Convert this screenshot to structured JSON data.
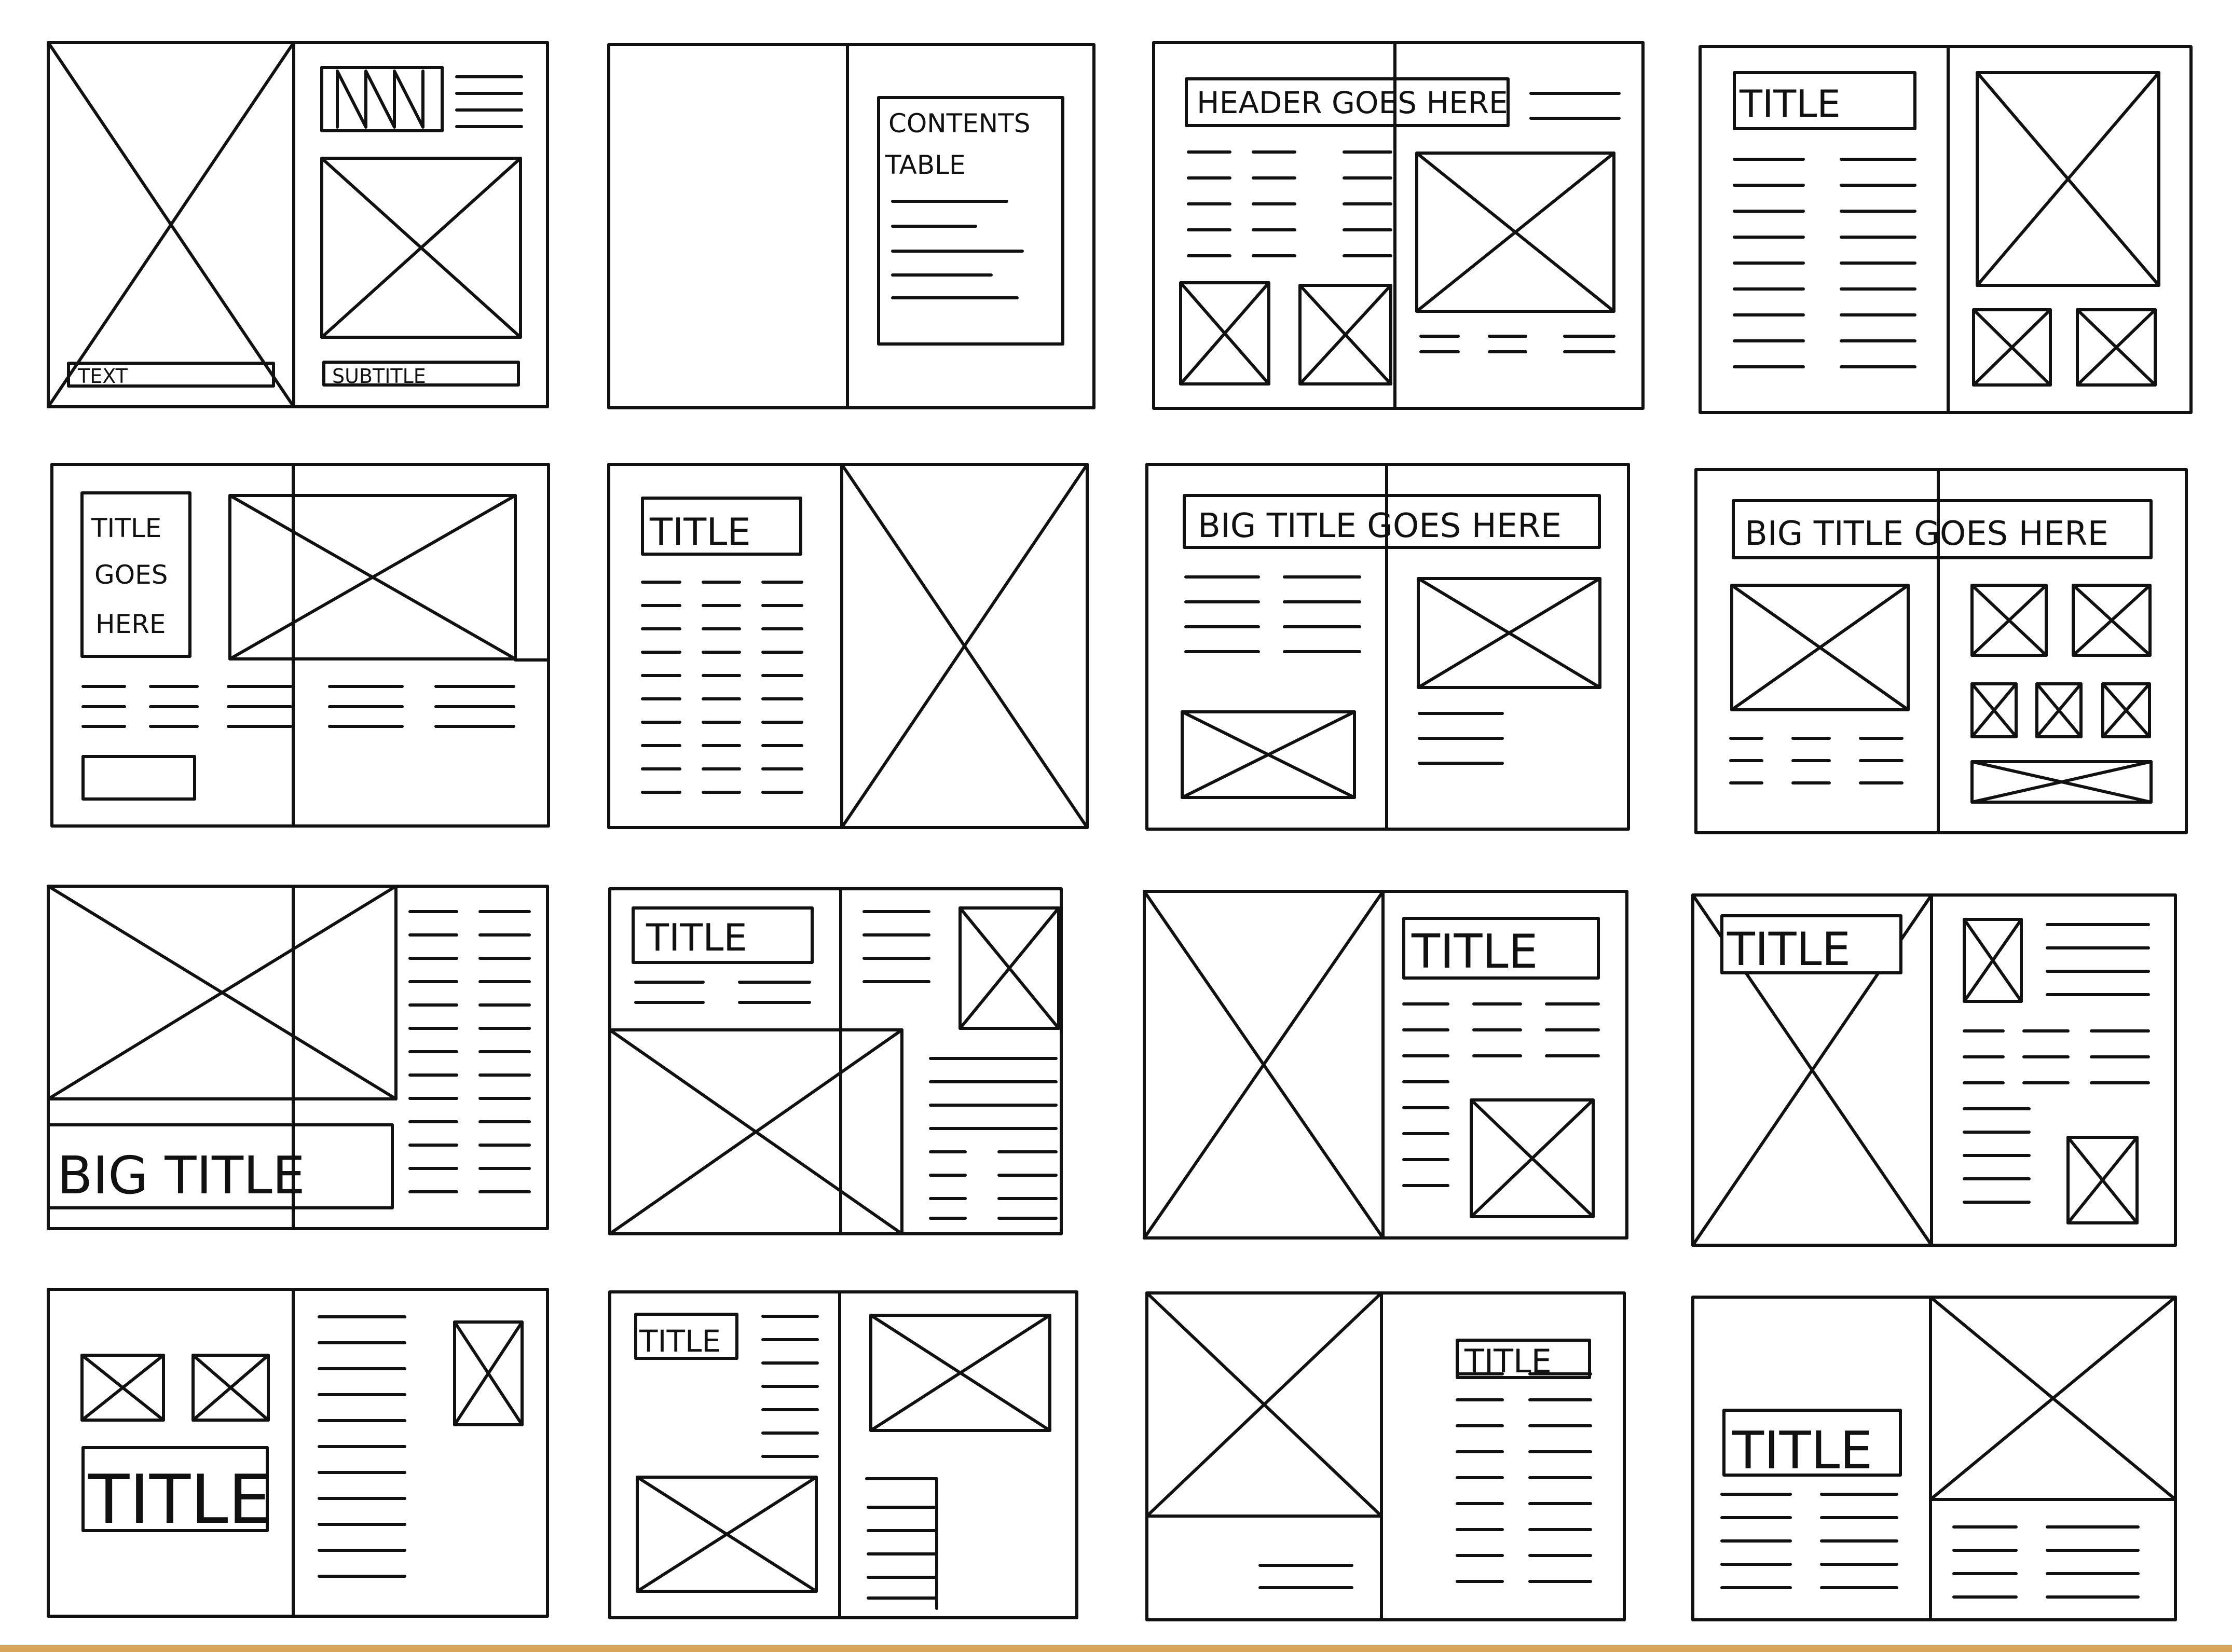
{
  "sheet": {
    "ink_color": "#111111",
    "paper_color": "#ffffff",
    "edge_accent_color": "#d8a45a",
    "spreads": [
      {
        "labels": [
          "TEXT",
          "SUBTITLE"
        ]
      },
      {
        "labels": [
          "CONTENTS",
          "TABLE"
        ]
      },
      {
        "labels": [
          "HEADER GOES HERE"
        ]
      },
      {
        "labels": [
          "TITLE"
        ]
      },
      {
        "labels": [
          "TITLE",
          "GOES",
          "HERE"
        ]
      },
      {
        "labels": [
          "TITLE"
        ]
      },
      {
        "labels": [
          "BIG TITLE GOES HERE"
        ]
      },
      {
        "labels": [
          "BIG TITLE GOES HERE"
        ]
      },
      {
        "labels": [
          "BIG TITLE"
        ]
      },
      {
        "labels": [
          "TITLE"
        ]
      },
      {
        "labels": [
          "TITLE"
        ]
      },
      {
        "labels": [
          "TITLE"
        ]
      },
      {
        "labels": [
          "TITLE"
        ]
      },
      {
        "labels": [
          "TITLE"
        ]
      },
      {
        "labels": [
          "TITLE"
        ]
      },
      {
        "labels": [
          "TITLE"
        ]
      }
    ]
  }
}
